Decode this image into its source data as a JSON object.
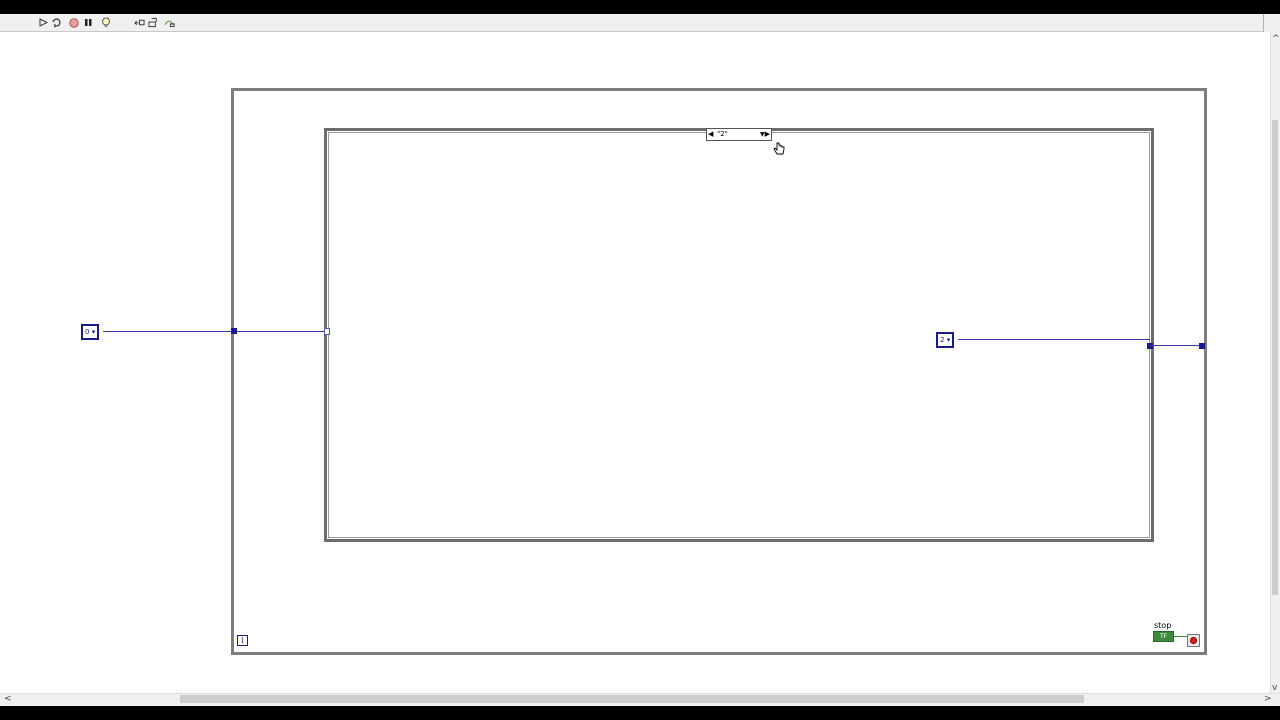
{
  "toolbar": {
    "icons": [
      "run-arrow-icon",
      "run-continuously-icon",
      "abort-icon",
      "pause-icon",
      "highlight-execution-icon",
      "retain-wire-values-icon",
      "step-into-icon",
      "step-over-icon"
    ]
  },
  "diagram": {
    "case_selector_label": "\"2\"",
    "enum_left_label": "0",
    "enum_right_label": "2",
    "iteration_terminal_label": "i",
    "stop_label": "stop",
    "stop_control_label": "TF"
  },
  "colors": {
    "enum_wire": "#3a3aa0",
    "boolean_wire": "#3e8a3e",
    "stop_button": "#e21a1a",
    "structure_border": "#7e7e7e"
  }
}
